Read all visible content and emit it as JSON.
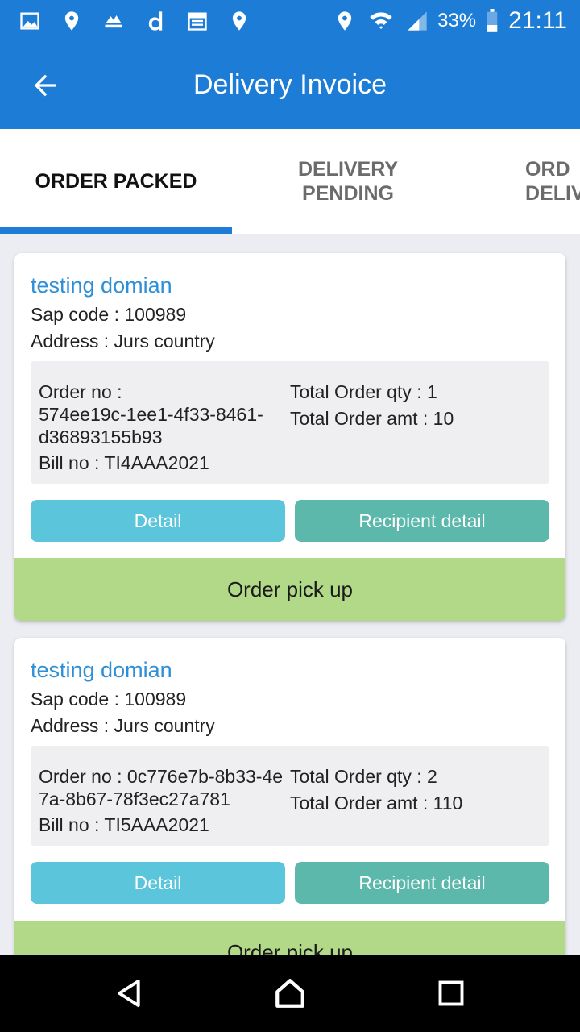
{
  "status_bar": {
    "left_icons": [
      "image-icon",
      "location-pin-icon",
      "order-me-icon",
      "d-app-icon",
      "calendar-icon",
      "location-pin-icon"
    ],
    "right_icons": [
      "location-pin-icon",
      "wifi-icon",
      "signal-icon",
      "battery-icon"
    ],
    "battery": "33%",
    "time": "21:11"
  },
  "app_bar": {
    "back_icon": "arrow-back-icon",
    "title": "Delivery Invoice"
  },
  "tabs": [
    {
      "line1": "ORDER PACKED",
      "line2": "",
      "active": true
    },
    {
      "line1": "DELIVERY",
      "line2": "PENDING",
      "active": false
    },
    {
      "line1": "ORD",
      "line2": "DELIV",
      "active": false
    }
  ],
  "orders": [
    {
      "name": "testing domian",
      "sap_code": "Sap code : 100989",
      "address": "Address : Jurs country",
      "order_no_line1": "Order no :",
      "order_no_line2": "574ee19c-1ee1-4f33-8461-",
      "order_no_line3": "d36893155b93",
      "bill_no": "Bill no : TI4AAA2021",
      "total_qty": "Total Order qty : 1",
      "total_amt": "Total Order amt : 10",
      "detail_label": "Detail",
      "recipient_label": "Recipient detail",
      "pickup_label": "Order pick up"
    },
    {
      "name": "testing domian",
      "sap_code": "Sap code : 100989",
      "address": "Address : Jurs country",
      "order_no_line1": "Order no : 0c776e7b-8b33-4e",
      "order_no_line2": "7a-8b67-78f3ec27a781",
      "bill_no": "Bill no : TI5AAA2021",
      "total_qty": "Total Order qty : 2",
      "total_amt": "Total Order amt : 110",
      "detail_label": "Detail",
      "recipient_label": "Recipient detail",
      "pickup_label": "Order pick up"
    }
  ],
  "nav_bar": {
    "icons": [
      "back-triangle-icon",
      "home-icon",
      "recents-icon"
    ]
  },
  "colors": {
    "primary": "#1c7cd6",
    "name_link": "#2e8fd6",
    "detail_button": "#5bc5db",
    "recipient_button": "#5cb8ab",
    "pickup_bar": "#b2d987"
  }
}
